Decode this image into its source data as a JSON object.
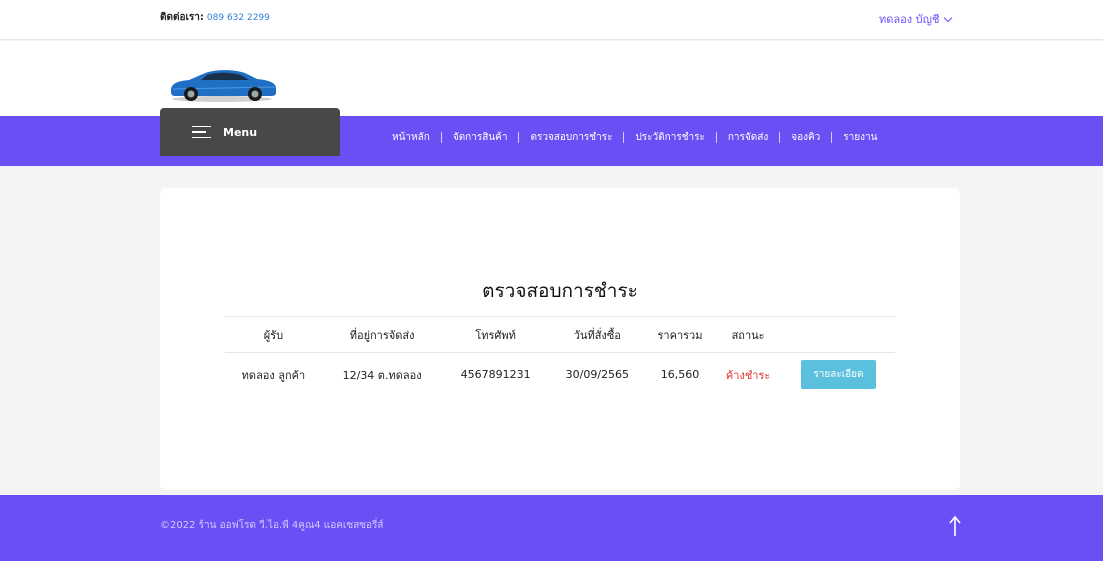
{
  "topbar": {
    "contact_label": "ติดต่อเรา:",
    "contact_phone": "089 632 2299",
    "account_label": "ทดลอง บัญชี"
  },
  "brand": {
    "logo_icon": "car-logo-icon",
    "logo_color": "#1f6fc4"
  },
  "menu": {
    "label": "Menu",
    "icon": "hamburger-icon"
  },
  "nav": {
    "items": [
      {
        "label": "หน้าหลัก"
      },
      {
        "label": "จัดการสินค้า"
      },
      {
        "label": "ตรวจสอบการชำระ"
      },
      {
        "label": "ประวัติการชำระ"
      },
      {
        "label": "การจัดส่ง"
      },
      {
        "label": "จองคิว"
      },
      {
        "label": "รายงาน"
      }
    ]
  },
  "main": {
    "title": "ตรวจสอบการชำระ",
    "table": {
      "headers": [
        "ผู้รับ",
        "ที่อยู่การจัดส่ง",
        "โทรศัพท์",
        "วันที่สั่งซื้อ",
        "ราคารวม",
        "สถานะ"
      ],
      "rows": [
        {
          "recipient": "ทดลอง ลูกค้า",
          "address": "12/34 ต.ทดลอง",
          "phone": "4567891231",
          "order_date": "30/09/2565",
          "total": "16,560",
          "status": "ค้างชำระ",
          "action_label": "รายละเอียด"
        }
      ]
    }
  },
  "footer": {
    "copyright": "©2022 ร้าน ออฟโรด วี.ไอ.พี 4คูณ4 แอคเซสซอรี่ส์",
    "to_top_icon": "arrow-up-icon"
  },
  "colors": {
    "accent": "#6b4ff5",
    "menu_bg": "#484848",
    "status_unpaid": "#e0342f",
    "button_info": "#5bc0de",
    "link_blue": "#2e7fd8"
  }
}
